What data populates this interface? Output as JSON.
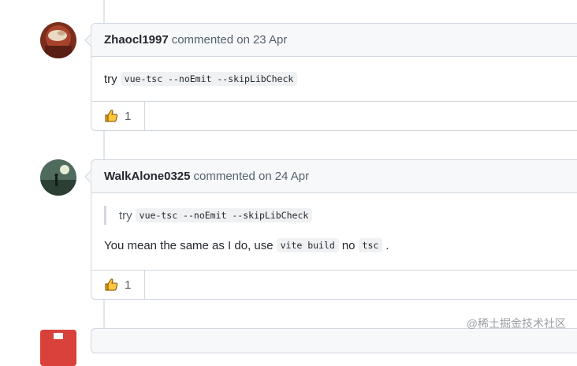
{
  "comments": [
    {
      "author": "Zhaocl1997",
      "action": "commented on",
      "date": "23 Apr",
      "text_prefix": "try",
      "code": "vue-tsc --noEmit --skipLibCheck",
      "reaction": {
        "icon": "thumbs-up-icon",
        "count": "1"
      }
    },
    {
      "author": "WalkAlone0325",
      "action": "commented on",
      "date": "24 Apr",
      "quote_prefix": "try",
      "quote_code": "vue-tsc --noEmit --skipLibCheck",
      "reply_part1": "You mean the same as I do, use",
      "reply_code1": "vite build",
      "reply_part2": "no",
      "reply_code2": "tsc",
      "reply_part3": ".",
      "reaction": {
        "icon": "thumbs-up-icon",
        "count": "1"
      }
    }
  ],
  "watermark": "@稀土掘金技术社区",
  "colors": {
    "border": "#d0d7de",
    "header_bg": "#f6f8fa",
    "code_bg": "#eff1f3",
    "muted": "#57606a",
    "thumb": "#f2a100"
  }
}
